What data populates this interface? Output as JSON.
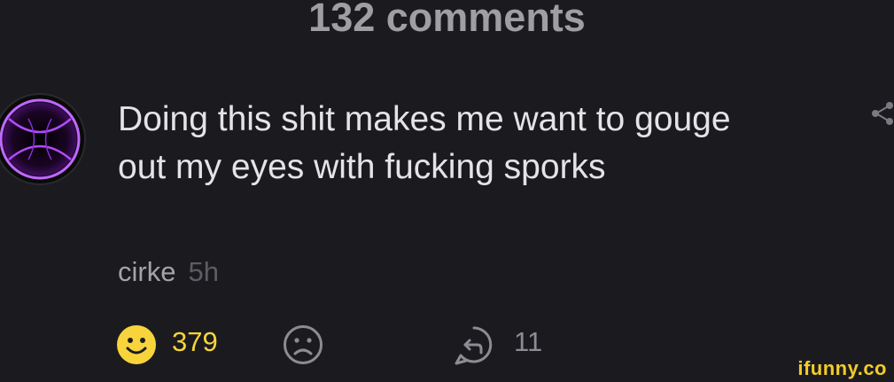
{
  "header": {
    "comments_count": "132 comments"
  },
  "comment": {
    "text": "Doing this shit makes me want to gouge out my eyes with fucking sporks",
    "author": "cirke",
    "time": "5h",
    "upvotes": "379",
    "replies": "11"
  },
  "icons": {
    "avatar": "avatar-image",
    "share": "share-icon",
    "smile": "smile-icon",
    "frown": "frown-icon",
    "reply": "reply-icon"
  },
  "watermark": "ifunny.co",
  "colors": {
    "background": "#1b1b1f",
    "accent_yellow": "#f7d43b",
    "avatar_purple": "#b04bff"
  }
}
